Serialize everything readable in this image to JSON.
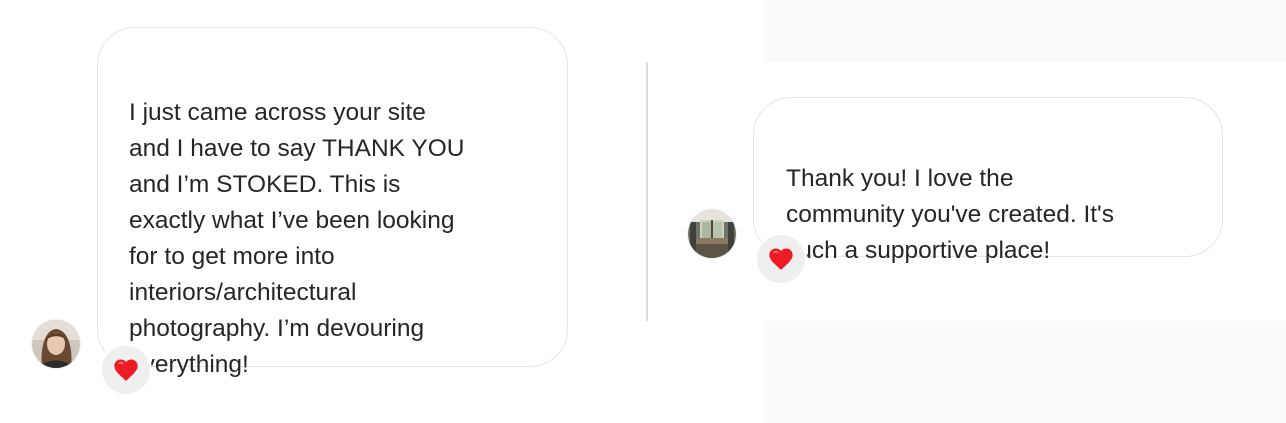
{
  "conversation_left": {
    "message_text": "I just came across your site\nand I have to say THANK YOU\nand I’m STOKED. This is\nexactly what I’ve been looking\nfor to get more into\ninteriors/architectural\nphotography. I’m devouring\neverything!",
    "avatar": "user-avatar-photo",
    "reaction": "heart-icon",
    "reaction_color": "#ed1c24"
  },
  "conversation_right": {
    "message_text": "Thank you! I love the\ncommunity you've created. It's\nsuch a supportive place!",
    "avatar": "interior-room-avatar-photo",
    "reaction": "heart-icon",
    "reaction_color": "#ed1c24"
  },
  "colors": {
    "background": "#ffffff",
    "panel_background": "#fafafa",
    "bubble_border": "#e6e6e6",
    "reaction_background": "#efefef",
    "text": "#262626",
    "divider": "#dbdbdb"
  }
}
